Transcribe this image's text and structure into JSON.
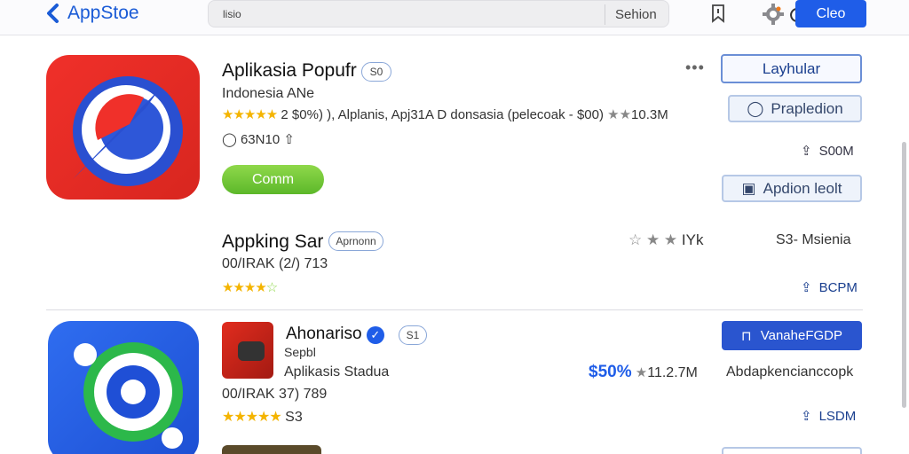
{
  "topbar": {
    "back_label": "AppStoe",
    "search_placeholder": "lisio",
    "search_label": "Sehion",
    "cta_label": "Cleo"
  },
  "icons": {
    "back": "chevron-left-icon",
    "refresh": "refresh-icon",
    "bookmark": "bookmark-icon",
    "settings": "gear-icon"
  },
  "apps": [
    {
      "title": "Aplikasia Popufr",
      "badge": "S0",
      "subtitle": "Indonesia ANe",
      "rating_line": "2 $0%) ), Alplanis, Apj31A D donsasia (pelecoak - $00)",
      "rating_count": "10.3M",
      "meta": "63N10",
      "open_label": "Comm",
      "primary_button": "Layhular",
      "secondary_button": "Prapledion",
      "size": "S00M",
      "tertiary_button": "Apdion leolt"
    },
    {
      "title": "Appking Sar",
      "badge": "Aprnonn",
      "subtitle": "00/IRAK (2/)  713",
      "rating_count": "IYk",
      "right_label": "S3- Msienia",
      "size": "BCPM"
    },
    {
      "title": "Ahonariso",
      "badge": "S1",
      "subtitle": "Sepbl",
      "subtitle2": "Aplikasis Stadua",
      "meta": "00/IRAK 37)  789",
      "rating_extra": "S3",
      "price": "$50%",
      "rating_count": "11.2.7M",
      "right_label": "Abdapkencianccopk",
      "primary_button": "VanaheFGDP",
      "size": "LSDM"
    }
  ],
  "colors": {
    "accent": "#1f5de8",
    "star": "#f4b400",
    "green": "#6cc436"
  }
}
